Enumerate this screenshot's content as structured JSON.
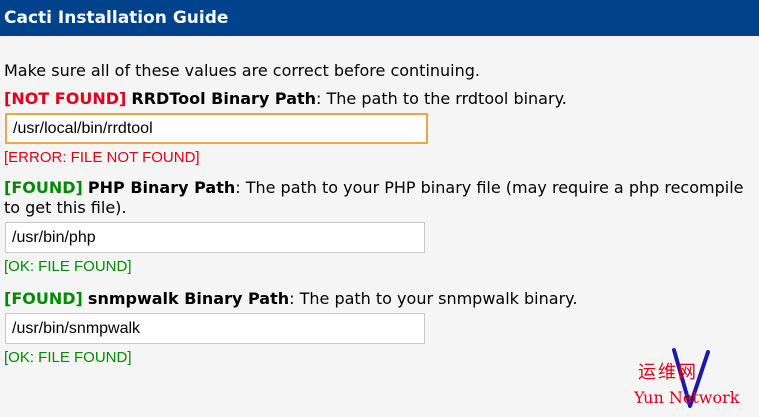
{
  "header": {
    "title": "Cacti Installation Guide"
  },
  "intro": "Make sure all of these values are correct before continuing.",
  "fields": [
    {
      "status": "[NOT FOUND]",
      "name": "RRDTool Binary Path",
      "description": ": The path to the rrdtool binary.",
      "value": "/usr/local/bin/rrdtool",
      "result": "[ERROR: FILE NOT FOUND]"
    },
    {
      "status": "[FOUND]",
      "name": "PHP Binary Path",
      "description": ": The path to your PHP binary file (may require a php recompile to get this file).",
      "value": "/usr/bin/php",
      "result": "[OK: FILE FOUND]"
    },
    {
      "status": "[FOUND]",
      "name": "snmpwalk Binary Path",
      "description": ": The path to your snmpwalk binary.",
      "value": "/usr/bin/snmpwalk",
      "result": "[OK: FILE FOUND]"
    }
  ],
  "watermark": {
    "cn": "运维网",
    "en": "Yun Network"
  },
  "colors": {
    "header_bg": "#00438c",
    "error": "#e0001b",
    "ok": "#008a00",
    "focus_border": "#e6a94a"
  }
}
